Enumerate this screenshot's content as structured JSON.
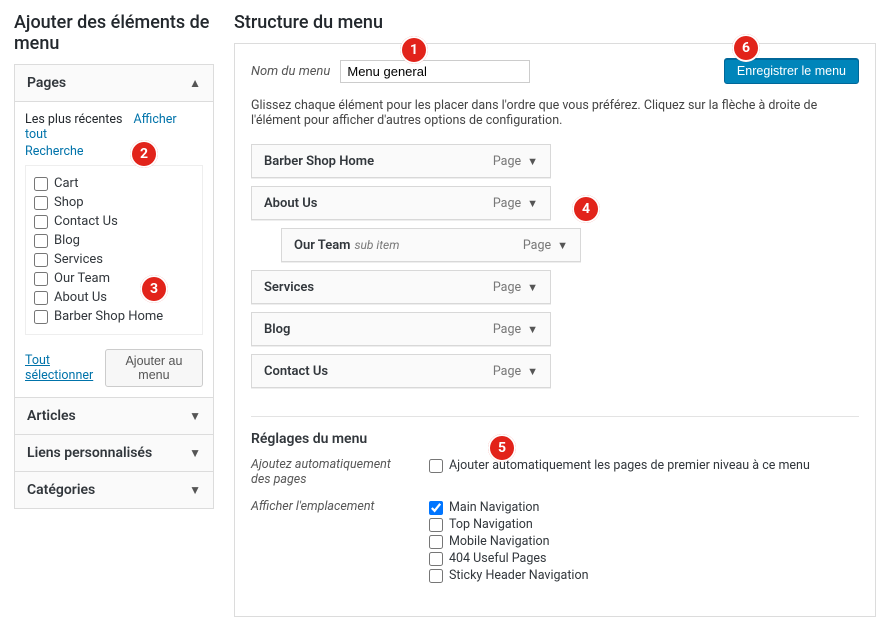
{
  "annotations": [
    "1",
    "2",
    "3",
    "4",
    "5",
    "6"
  ],
  "left": {
    "heading": "Ajouter des éléments de menu",
    "pages_accordion": {
      "title": "Pages",
      "tabs": {
        "recent": "Les plus récentes",
        "all": "Afficher tout",
        "search": "Recherche"
      },
      "items": [
        "Cart",
        "Shop",
        "Contact Us",
        "Blog",
        "Services",
        "Our Team",
        "About Us",
        "Barber Shop Home"
      ],
      "select_all": "Tout sélectionner",
      "add_btn": "Ajouter au menu"
    },
    "other": {
      "articles": "Articles",
      "links": "Liens personnalisés",
      "categories": "Catégories"
    }
  },
  "right": {
    "heading": "Structure du menu",
    "name_label": "Nom du menu",
    "name_value": "Menu general",
    "save_btn": "Enregistrer le menu",
    "hint": "Glissez chaque élément pour les placer dans l'ordre que vous préférez. Cliquez sur la flèche à droite de l'élément pour afficher d'autres options de configuration.",
    "type_label": "Page",
    "sub_item_label": "sub item",
    "items": [
      {
        "name": "Barber Shop Home",
        "indent": 0,
        "sub": false
      },
      {
        "name": "About Us",
        "indent": 0,
        "sub": false
      },
      {
        "name": "Our Team",
        "indent": 1,
        "sub": true
      },
      {
        "name": "Services",
        "indent": 0,
        "sub": false
      },
      {
        "name": "Blog",
        "indent": 0,
        "sub": false
      },
      {
        "name": "Contact Us",
        "indent": 0,
        "sub": false
      }
    ],
    "settings": {
      "title": "Réglages du menu",
      "auto_label": "Ajoutez automatiquement des pages",
      "auto_cb": "Ajouter automatiquement les pages de premier niveau à ce menu",
      "loc_label": "Afficher l'emplacement",
      "locations": [
        {
          "label": "Main Navigation",
          "checked": true
        },
        {
          "label": "Top Navigation",
          "checked": false
        },
        {
          "label": "Mobile Navigation",
          "checked": false
        },
        {
          "label": "404 Useful Pages",
          "checked": false
        },
        {
          "label": "Sticky Header Navigation",
          "checked": false
        }
      ]
    }
  }
}
